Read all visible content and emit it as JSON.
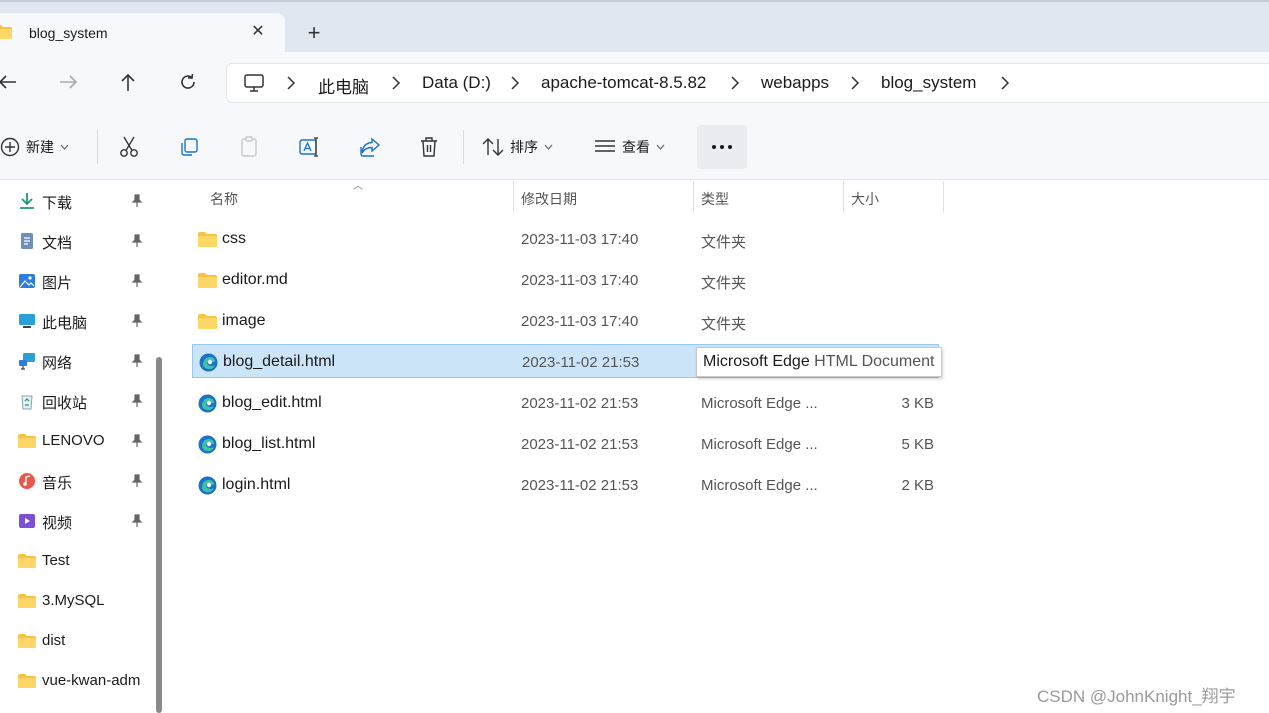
{
  "window": {
    "tab_title": "blog_system",
    "tab_close": "✕",
    "new_tab": "+"
  },
  "address": {
    "crumbs": [
      "此电脑",
      "Data (D:)",
      "apache-tomcat-8.5.82",
      "webapps",
      "blog_system"
    ]
  },
  "toolbar": {
    "new_label": "新建",
    "sort_label": "排序",
    "view_label": "查看"
  },
  "sidebar": {
    "items": [
      {
        "label": "下载",
        "icon": "download-icon",
        "pinned": true
      },
      {
        "label": "文档",
        "icon": "document-icon",
        "pinned": true
      },
      {
        "label": "图片",
        "icon": "pictures-icon",
        "pinned": true
      },
      {
        "label": "此电脑",
        "icon": "computer-icon",
        "pinned": true
      },
      {
        "label": "网络",
        "icon": "network-icon",
        "pinned": true
      },
      {
        "label": "回收站",
        "icon": "recycle-bin-icon",
        "pinned": true
      },
      {
        "label": "LENOVO",
        "icon": "folder-icon",
        "pinned": true
      },
      {
        "label": "音乐",
        "icon": "music-icon",
        "pinned": true
      },
      {
        "label": "视频",
        "icon": "video-icon",
        "pinned": true
      },
      {
        "label": "Test",
        "icon": "folder-icon",
        "pinned": false
      },
      {
        "label": "3.MySQL",
        "icon": "folder-icon",
        "pinned": false
      },
      {
        "label": "dist",
        "icon": "folder-icon",
        "pinned": false
      },
      {
        "label": "vue-kwan-adm",
        "icon": "folder-icon",
        "pinned": false
      }
    ]
  },
  "columns": {
    "name": "名称",
    "modified": "修改日期",
    "type": "类型",
    "size": "大小"
  },
  "files": [
    {
      "name": "css",
      "modified": "2023-11-03 17:40",
      "type": "文件夹",
      "size": "",
      "icon": "folder-icon"
    },
    {
      "name": "editor.md",
      "modified": "2023-11-03 17:40",
      "type": "文件夹",
      "size": "",
      "icon": "folder-icon"
    },
    {
      "name": "image",
      "modified": "2023-11-03 17:40",
      "type": "文件夹",
      "size": "",
      "icon": "folder-icon"
    },
    {
      "name": "blog_detail.html",
      "modified": "2023-11-02 21:53",
      "type": "",
      "size": "",
      "icon": "edge-icon",
      "selected": true
    },
    {
      "name": "blog_edit.html",
      "modified": "2023-11-02 21:53",
      "type": "Microsoft Edge ...",
      "size": "3 KB",
      "icon": "edge-icon"
    },
    {
      "name": "blog_list.html",
      "modified": "2023-11-02 21:53",
      "type": "Microsoft Edge ...",
      "size": "5 KB",
      "icon": "edge-icon"
    },
    {
      "name": "login.html",
      "modified": "2023-11-02 21:53",
      "type": "Microsoft Edge ...",
      "size": "2 KB",
      "icon": "edge-icon"
    }
  ],
  "tooltip": {
    "part1": "Microsoft Edge",
    "part2": " HTML Document"
  },
  "watermark": "CSDN @JohnKnight_翔宇",
  "colors": {
    "titlebar": "#e1e7f1",
    "selection": "#cce4f7",
    "folder": "#f6c343",
    "edge_blue": "#1a73c8"
  }
}
